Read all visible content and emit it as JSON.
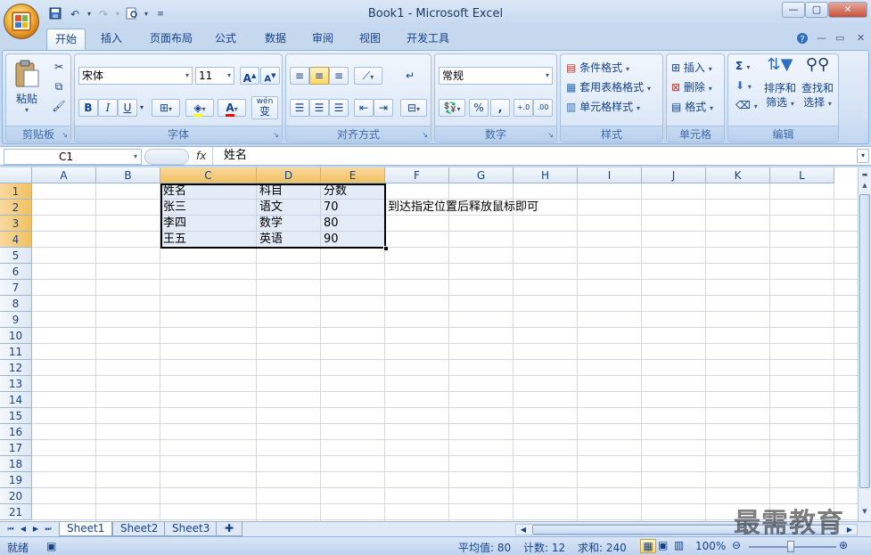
{
  "window": {
    "title": "Book1 - Microsoft Excel"
  },
  "qat": [
    "save-icon",
    "undo-icon",
    "redo-icon",
    "print-preview-icon"
  ],
  "tabs": [
    "开始",
    "插入",
    "页面布局",
    "公式",
    "数据",
    "审阅",
    "视图",
    "开发工具"
  ],
  "ribbon": {
    "clipboard": {
      "label": "剪贴板",
      "paste": "粘贴"
    },
    "font": {
      "label": "字体",
      "name": "宋体",
      "size": "11",
      "bold": "B",
      "italic": "I",
      "underline": "U",
      "phonetic": "wén",
      "phonetic2": "变"
    },
    "alignment": {
      "label": "对齐方式"
    },
    "number": {
      "label": "数字",
      "format": "常规",
      "percent": "%",
      "comma": ","
    },
    "styles": {
      "label": "样式",
      "conditional": "条件格式",
      "table": "套用表格格式",
      "cell_styles": "单元格样式"
    },
    "cells": {
      "label": "单元格",
      "insert": "插入",
      "delete": "删除",
      "format": "格式"
    },
    "editing": {
      "label": "编辑",
      "sigma": "Σ",
      "sort": "排序和",
      "sort2": "筛选",
      "find": "查找和",
      "find2": "选择"
    }
  },
  "formula_bar": {
    "name_box": "C1",
    "fx": "fx",
    "content": "姓名"
  },
  "columns": [
    "A",
    "B",
    "C",
    "D",
    "E",
    "F",
    "G",
    "H",
    "I",
    "J",
    "K",
    "L"
  ],
  "selected_columns": [
    "C",
    "D",
    "E"
  ],
  "rows": [
    "1",
    "2",
    "3",
    "4",
    "5",
    "6",
    "7",
    "8",
    "9",
    "10",
    "11",
    "12",
    "13",
    "14",
    "15",
    "16",
    "17",
    "18",
    "19",
    "20",
    "21"
  ],
  "selected_rows": [
    "1",
    "2",
    "3",
    "4"
  ],
  "cells": {
    "C1": "姓名",
    "D1": "科目",
    "E1": "分数",
    "C2": "张三",
    "D2": "语文",
    "E2": "70",
    "C3": "李四",
    "D3": "数学",
    "E3": "80",
    "C4": "王五",
    "D4": "英语",
    "E4": "90",
    "F2": "到达指定位置后释放鼠标即可"
  },
  "sheets": [
    "Sheet1",
    "Sheet2",
    "Sheet3"
  ],
  "active_sheet": "Sheet1",
  "status": {
    "mode": "就绪",
    "average": "平均值: 80",
    "count": "计数: 12",
    "sum": "求和: 240",
    "zoom": "100%"
  },
  "watermark": "最需教育"
}
